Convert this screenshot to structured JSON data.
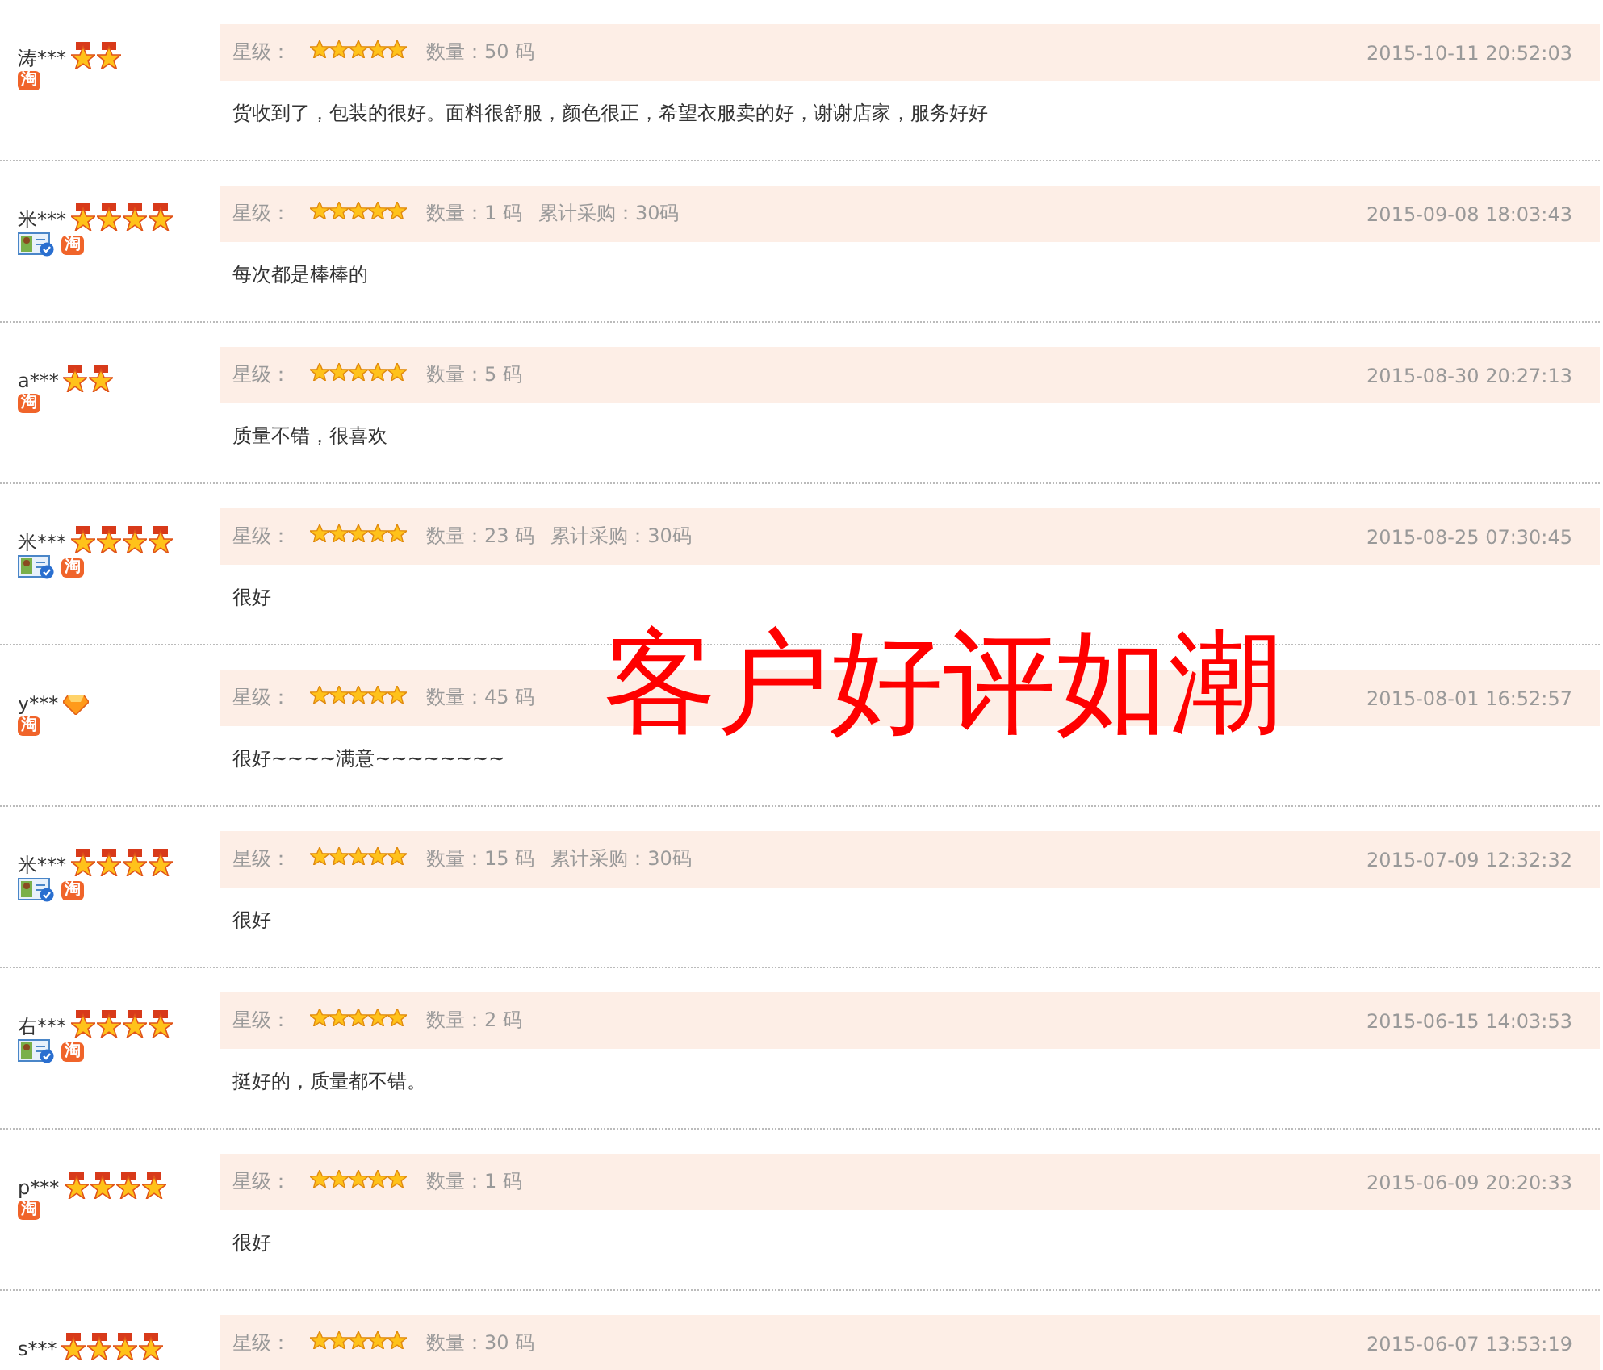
{
  "overlay_caption": "客户好评如潮",
  "reviews": [
    {
      "user": "涛***",
      "rank": [
        {
          "kind": "medal"
        },
        {
          "kind": "medal"
        }
      ],
      "verified": false,
      "taobao_badge": "淘",
      "rating_label": "星级：",
      "stars": 5,
      "quantity": "数量：50 码",
      "date": "2015-10-11 20:52:03",
      "comment": "货收到了，包装的很好。面料很舒服，颜色很正，希望衣服卖的好，谢谢店家，服务好好"
    },
    {
      "user": "米***",
      "rank": [
        {
          "kind": "medal"
        },
        {
          "kind": "medal"
        },
        {
          "kind": "medal"
        },
        {
          "kind": "medal"
        }
      ],
      "verified": true,
      "taobao_badge": "淘",
      "rating_label": "星级：",
      "stars": 5,
      "quantity": "数量：1 码",
      "cumulative": "累计采购：30码",
      "date": "2015-09-08 18:03:43",
      "comment": "每次都是棒棒的"
    },
    {
      "user": "a***",
      "rank": [
        {
          "kind": "medal"
        },
        {
          "kind": "medal"
        }
      ],
      "verified": false,
      "taobao_badge": "淘",
      "rating_label": "星级：",
      "stars": 5,
      "quantity": "数量：5 码",
      "date": "2015-08-30 20:27:13",
      "comment": "质量不错，很喜欢"
    },
    {
      "user": "米***",
      "rank": [
        {
          "kind": "medal"
        },
        {
          "kind": "medal"
        },
        {
          "kind": "medal"
        },
        {
          "kind": "medal"
        }
      ],
      "verified": true,
      "taobao_badge": "淘",
      "rating_label": "星级：",
      "stars": 5,
      "quantity": "数量：23 码",
      "cumulative": "累计采购：30码",
      "date": "2015-08-25 07:30:45",
      "comment": "很好"
    },
    {
      "user": "y***",
      "rank": [
        {
          "kind": "diamond"
        }
      ],
      "verified": false,
      "taobao_badge": "淘",
      "rating_label": "星级：",
      "stars": 5,
      "quantity": "数量：45 码",
      "date": "2015-08-01 16:52:57",
      "comment": "很好~~~~满意~~~~~~~~"
    },
    {
      "user": "米***",
      "rank": [
        {
          "kind": "medal"
        },
        {
          "kind": "medal"
        },
        {
          "kind": "medal"
        },
        {
          "kind": "medal"
        }
      ],
      "verified": true,
      "taobao_badge": "淘",
      "rating_label": "星级：",
      "stars": 5,
      "quantity": "数量：15 码",
      "cumulative": "累计采购：30码",
      "date": "2015-07-09 12:32:32",
      "comment": "很好"
    },
    {
      "user": "右***",
      "rank": [
        {
          "kind": "medal"
        },
        {
          "kind": "medal"
        },
        {
          "kind": "medal"
        },
        {
          "kind": "medal"
        }
      ],
      "verified": true,
      "taobao_badge": "淘",
      "rating_label": "星级：",
      "stars": 5,
      "quantity": "数量：2 码",
      "date": "2015-06-15 14:03:53",
      "comment": "挺好的，质量都不错。"
    },
    {
      "user": "p***",
      "rank": [
        {
          "kind": "medal"
        },
        {
          "kind": "medal"
        },
        {
          "kind": "medal"
        },
        {
          "kind": "medal"
        }
      ],
      "verified": false,
      "taobao_badge": "淘",
      "rating_label": "星级：",
      "stars": 5,
      "quantity": "数量：1 码",
      "date": "2015-06-09 20:20:33",
      "comment": "很好"
    },
    {
      "user": "s***",
      "rank": [
        {
          "kind": "medal"
        },
        {
          "kind": "medal"
        },
        {
          "kind": "medal"
        },
        {
          "kind": "medal"
        }
      ],
      "rating_label": "星级：",
      "stars": 5,
      "quantity": "数量：30 码",
      "date": "2015-06-07 13:53:19"
    }
  ]
}
